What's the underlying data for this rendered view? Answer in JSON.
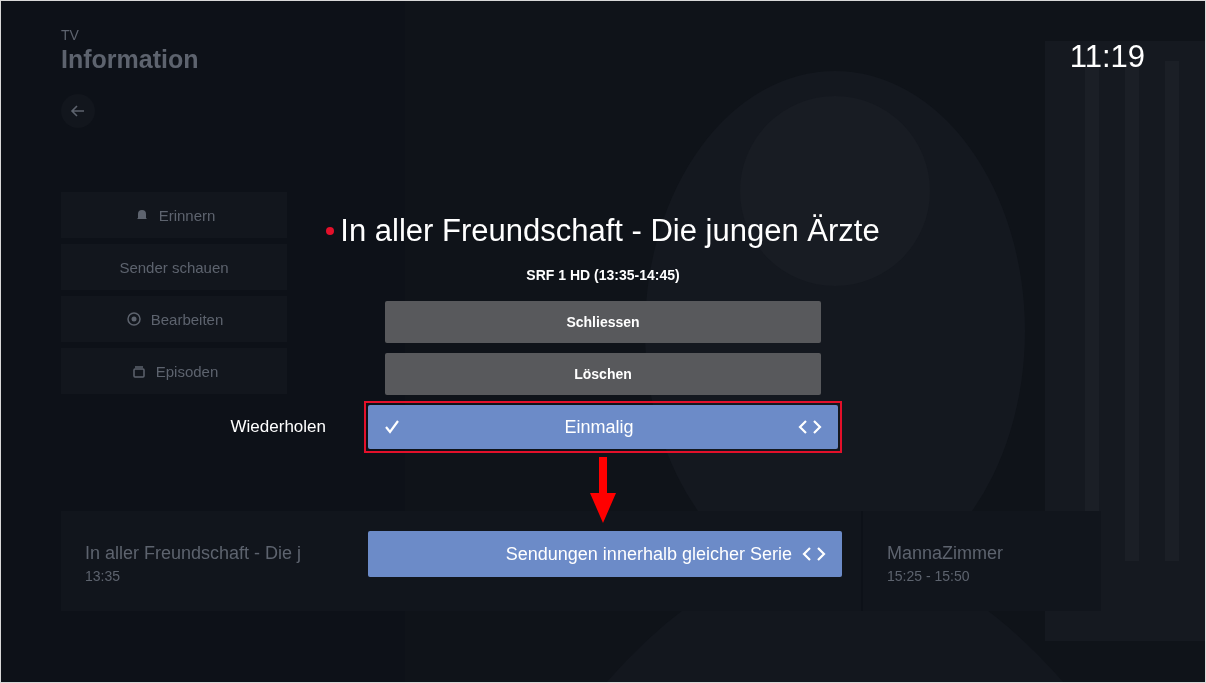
{
  "clock": "11:19",
  "background": {
    "category": "TV",
    "heading": "Information",
    "actions": [
      {
        "label": "Erinnern"
      },
      {
        "label": "Sender schauen"
      },
      {
        "label": "Bearbeiten"
      },
      {
        "label": "Episoden"
      }
    ],
    "guide": [
      {
        "title": "In aller Freundschaft - Die j",
        "time": "13:35"
      },
      {
        "title": "MannaZimmer",
        "time": "15:25 - 15:50"
      }
    ]
  },
  "dialog": {
    "title": "In aller Freundschaft - Die jungen Ärzte",
    "recording": true,
    "subtitle": "SRF 1 HD (13:35-14:45)",
    "buttons": [
      "Schliessen",
      "Löschen"
    ],
    "options": [
      {
        "label": "Wiederholen",
        "value": "Einmalig",
        "checked": true,
        "highlighted": true
      },
      {
        "value": "Sendungen innerhalb gleicher Serie",
        "checked": false,
        "highlighted": false
      }
    ]
  }
}
